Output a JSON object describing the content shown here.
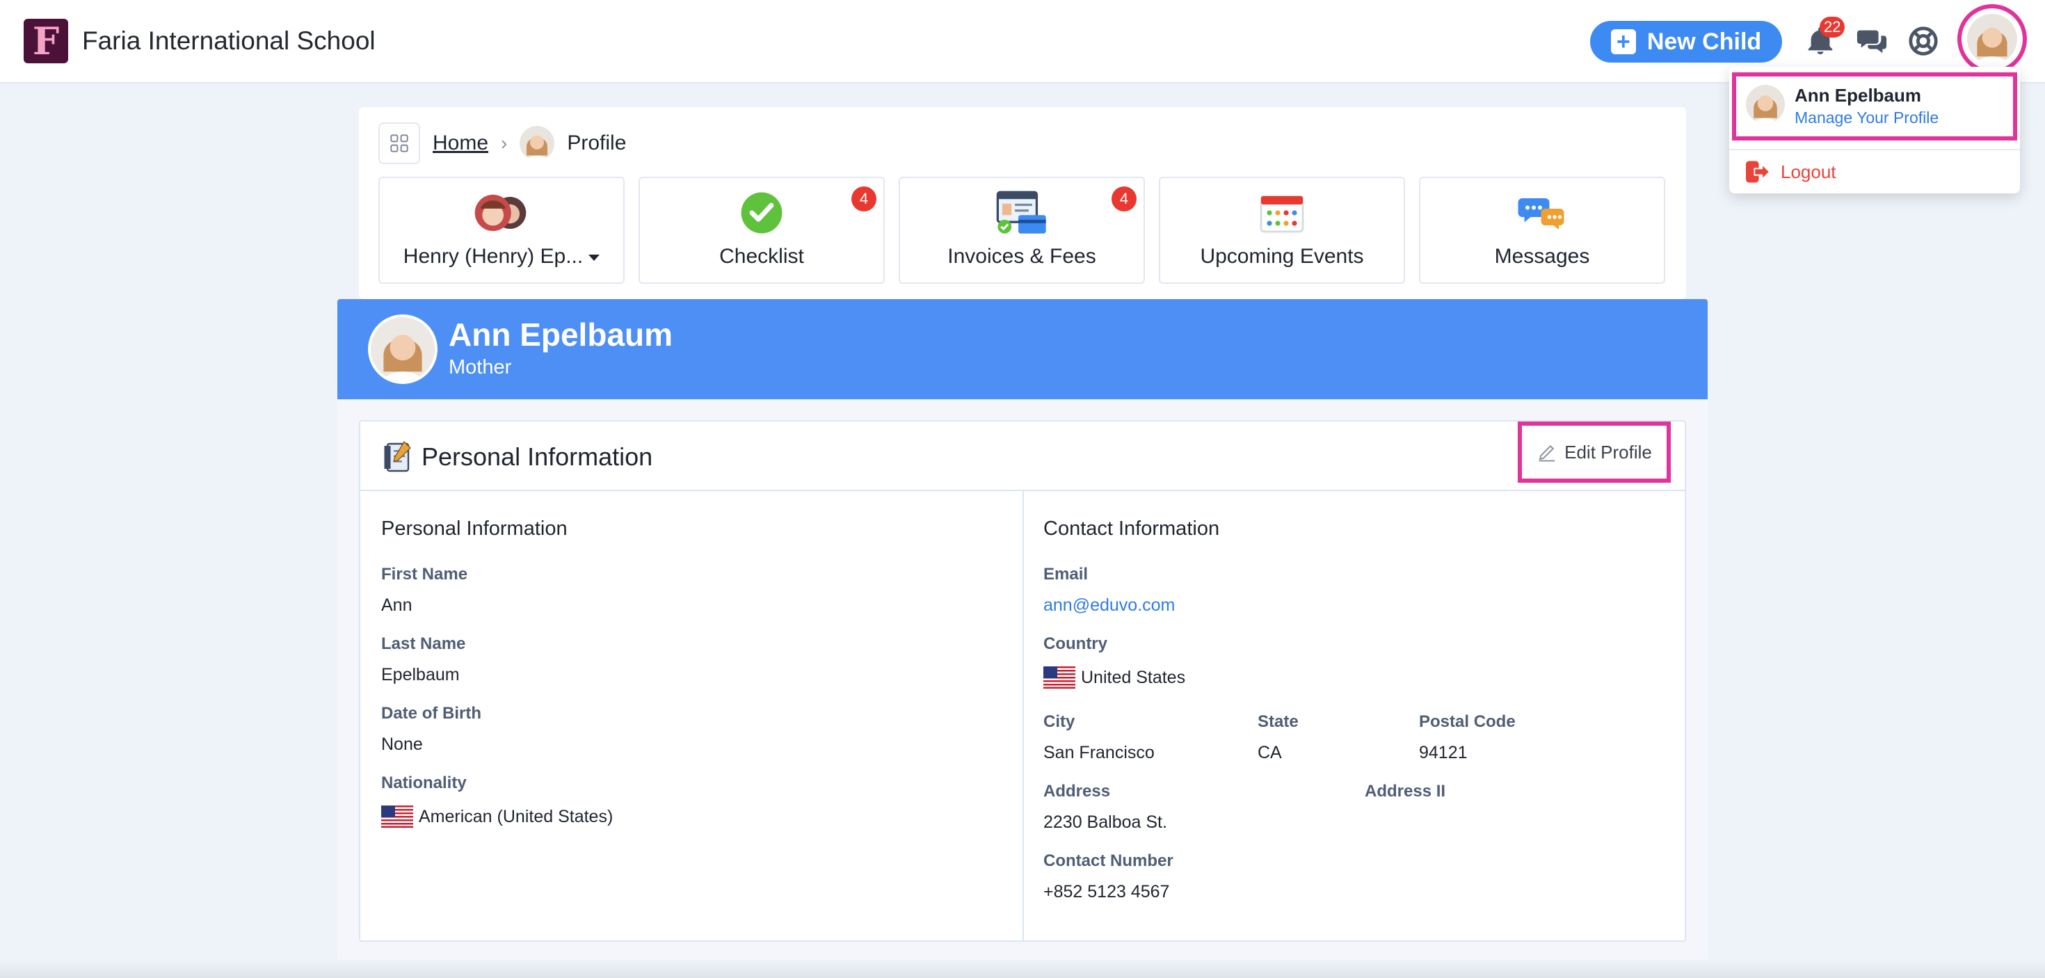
{
  "header": {
    "school_name": "Faria International School",
    "logo_letter": "F",
    "new_child_label": "New Child",
    "notification_count": "22"
  },
  "user_menu": {
    "name": "Ann Epelbaum",
    "manage_label": "Manage Your Profile",
    "logout_label": "Logout"
  },
  "breadcrumb": {
    "home": "Home",
    "current": "Profile"
  },
  "tiles": [
    {
      "label": "Henry (Henry) Ep...",
      "icon": "children-avatars-icon",
      "badge": ""
    },
    {
      "label": "Checklist",
      "icon": "checkmark-icon",
      "badge": "4"
    },
    {
      "label": "Invoices & Fees",
      "icon": "invoice-card-icon",
      "badge": "4"
    },
    {
      "label": "Upcoming Events",
      "icon": "calendar-icon",
      "badge": ""
    },
    {
      "label": "Messages",
      "icon": "chat-bubbles-icon",
      "badge": ""
    }
  ],
  "profile": {
    "name": "Ann Epelbaum",
    "role": "Mother"
  },
  "card": {
    "title": "Personal Information",
    "edit_label": "Edit Profile"
  },
  "personal": {
    "section_title": "Personal Information",
    "first_name_label": "First Name",
    "first_name": "Ann",
    "last_name_label": "Last Name",
    "last_name": "Epelbaum",
    "dob_label": "Date of Birth",
    "dob": "None",
    "nationality_label": "Nationality",
    "nationality": "American (United States)"
  },
  "contact": {
    "section_title": "Contact Information",
    "email_label": "Email",
    "email": "ann@eduvo.com",
    "country_label": "Country",
    "country": "United States",
    "city_label": "City",
    "city": "San Francisco",
    "state_label": "State",
    "state": "CA",
    "postal_label": "Postal Code",
    "postal": "94121",
    "address_label": "Address",
    "address": "2230 Balboa St.",
    "address2_label": "Address II",
    "address2": "",
    "phone_label": "Contact Number",
    "phone": "+852 5123 4567"
  },
  "colors": {
    "accent": "#3d8bf2",
    "banner": "#4d8ff5",
    "highlight": "#e0339b",
    "badge": "#e8382f",
    "logout": "#e8443a"
  }
}
